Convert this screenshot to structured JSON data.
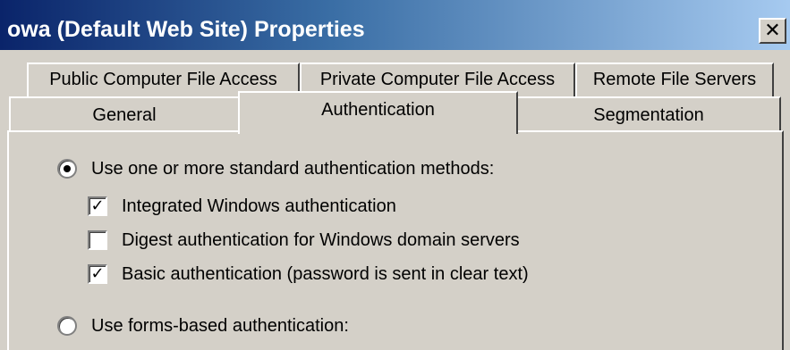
{
  "window": {
    "title": "owa (Default Web Site) Properties",
    "close_glyph": "✕"
  },
  "tabs": {
    "row1": [
      {
        "label": "Public Computer File Access"
      },
      {
        "label": "Private Computer File Access"
      },
      {
        "label": "Remote File Servers"
      }
    ],
    "row2": [
      {
        "label": "General"
      },
      {
        "label": "Authentication",
        "active": true
      },
      {
        "label": "Segmentation"
      }
    ]
  },
  "authentication": {
    "standard_option": {
      "label": "Use one or more standard authentication methods:",
      "selected": true
    },
    "methods": [
      {
        "label": "Integrated Windows authentication",
        "checked": true,
        "mark": "✓"
      },
      {
        "label": "Digest authentication for Windows domain servers",
        "checked": false,
        "mark": ""
      },
      {
        "label": "Basic authentication (password is sent in clear text)",
        "checked": true,
        "mark": "✓"
      }
    ],
    "forms_option": {
      "label": "Use forms-based authentication:",
      "selected": false
    }
  },
  "colors": {
    "title_gradient_start": "#0a246a",
    "title_gradient_end": "#a6caf0",
    "face": "#d4d0c8"
  }
}
